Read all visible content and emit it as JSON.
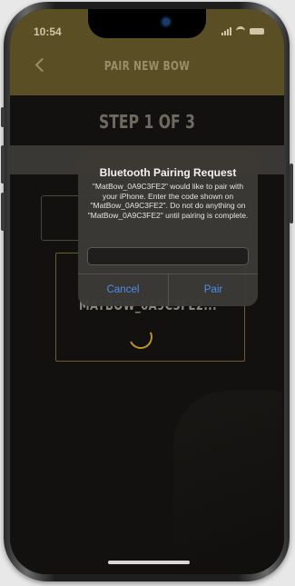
{
  "status_bar": {
    "time": "10:54",
    "icons": [
      "signal-icon",
      "wifi-icon",
      "battery-icon"
    ]
  },
  "nav": {
    "back_icon": "chevron-left-icon",
    "title": "PAIR NEW BOW"
  },
  "step": {
    "label": "STEP 1 OF 3"
  },
  "device": {
    "name": "MATBOW_0A9C3FE2..."
  },
  "alert": {
    "title": "Bluetooth Pairing Request",
    "message": "\"MatBow_0A9C3FE2\" would like to pair with your iPhone. Enter the code shown on \"MatBow_0A9C3FE2\". Do not do anything on \"MatBow_0A9C3FE2\" until pairing is complete.",
    "input_value": "",
    "cancel_label": "Cancel",
    "pair_label": "Pair"
  },
  "colors": {
    "accent": "#b8942a",
    "header_bg": "#5a4e24",
    "ios_blue": "#4a8ef0"
  }
}
